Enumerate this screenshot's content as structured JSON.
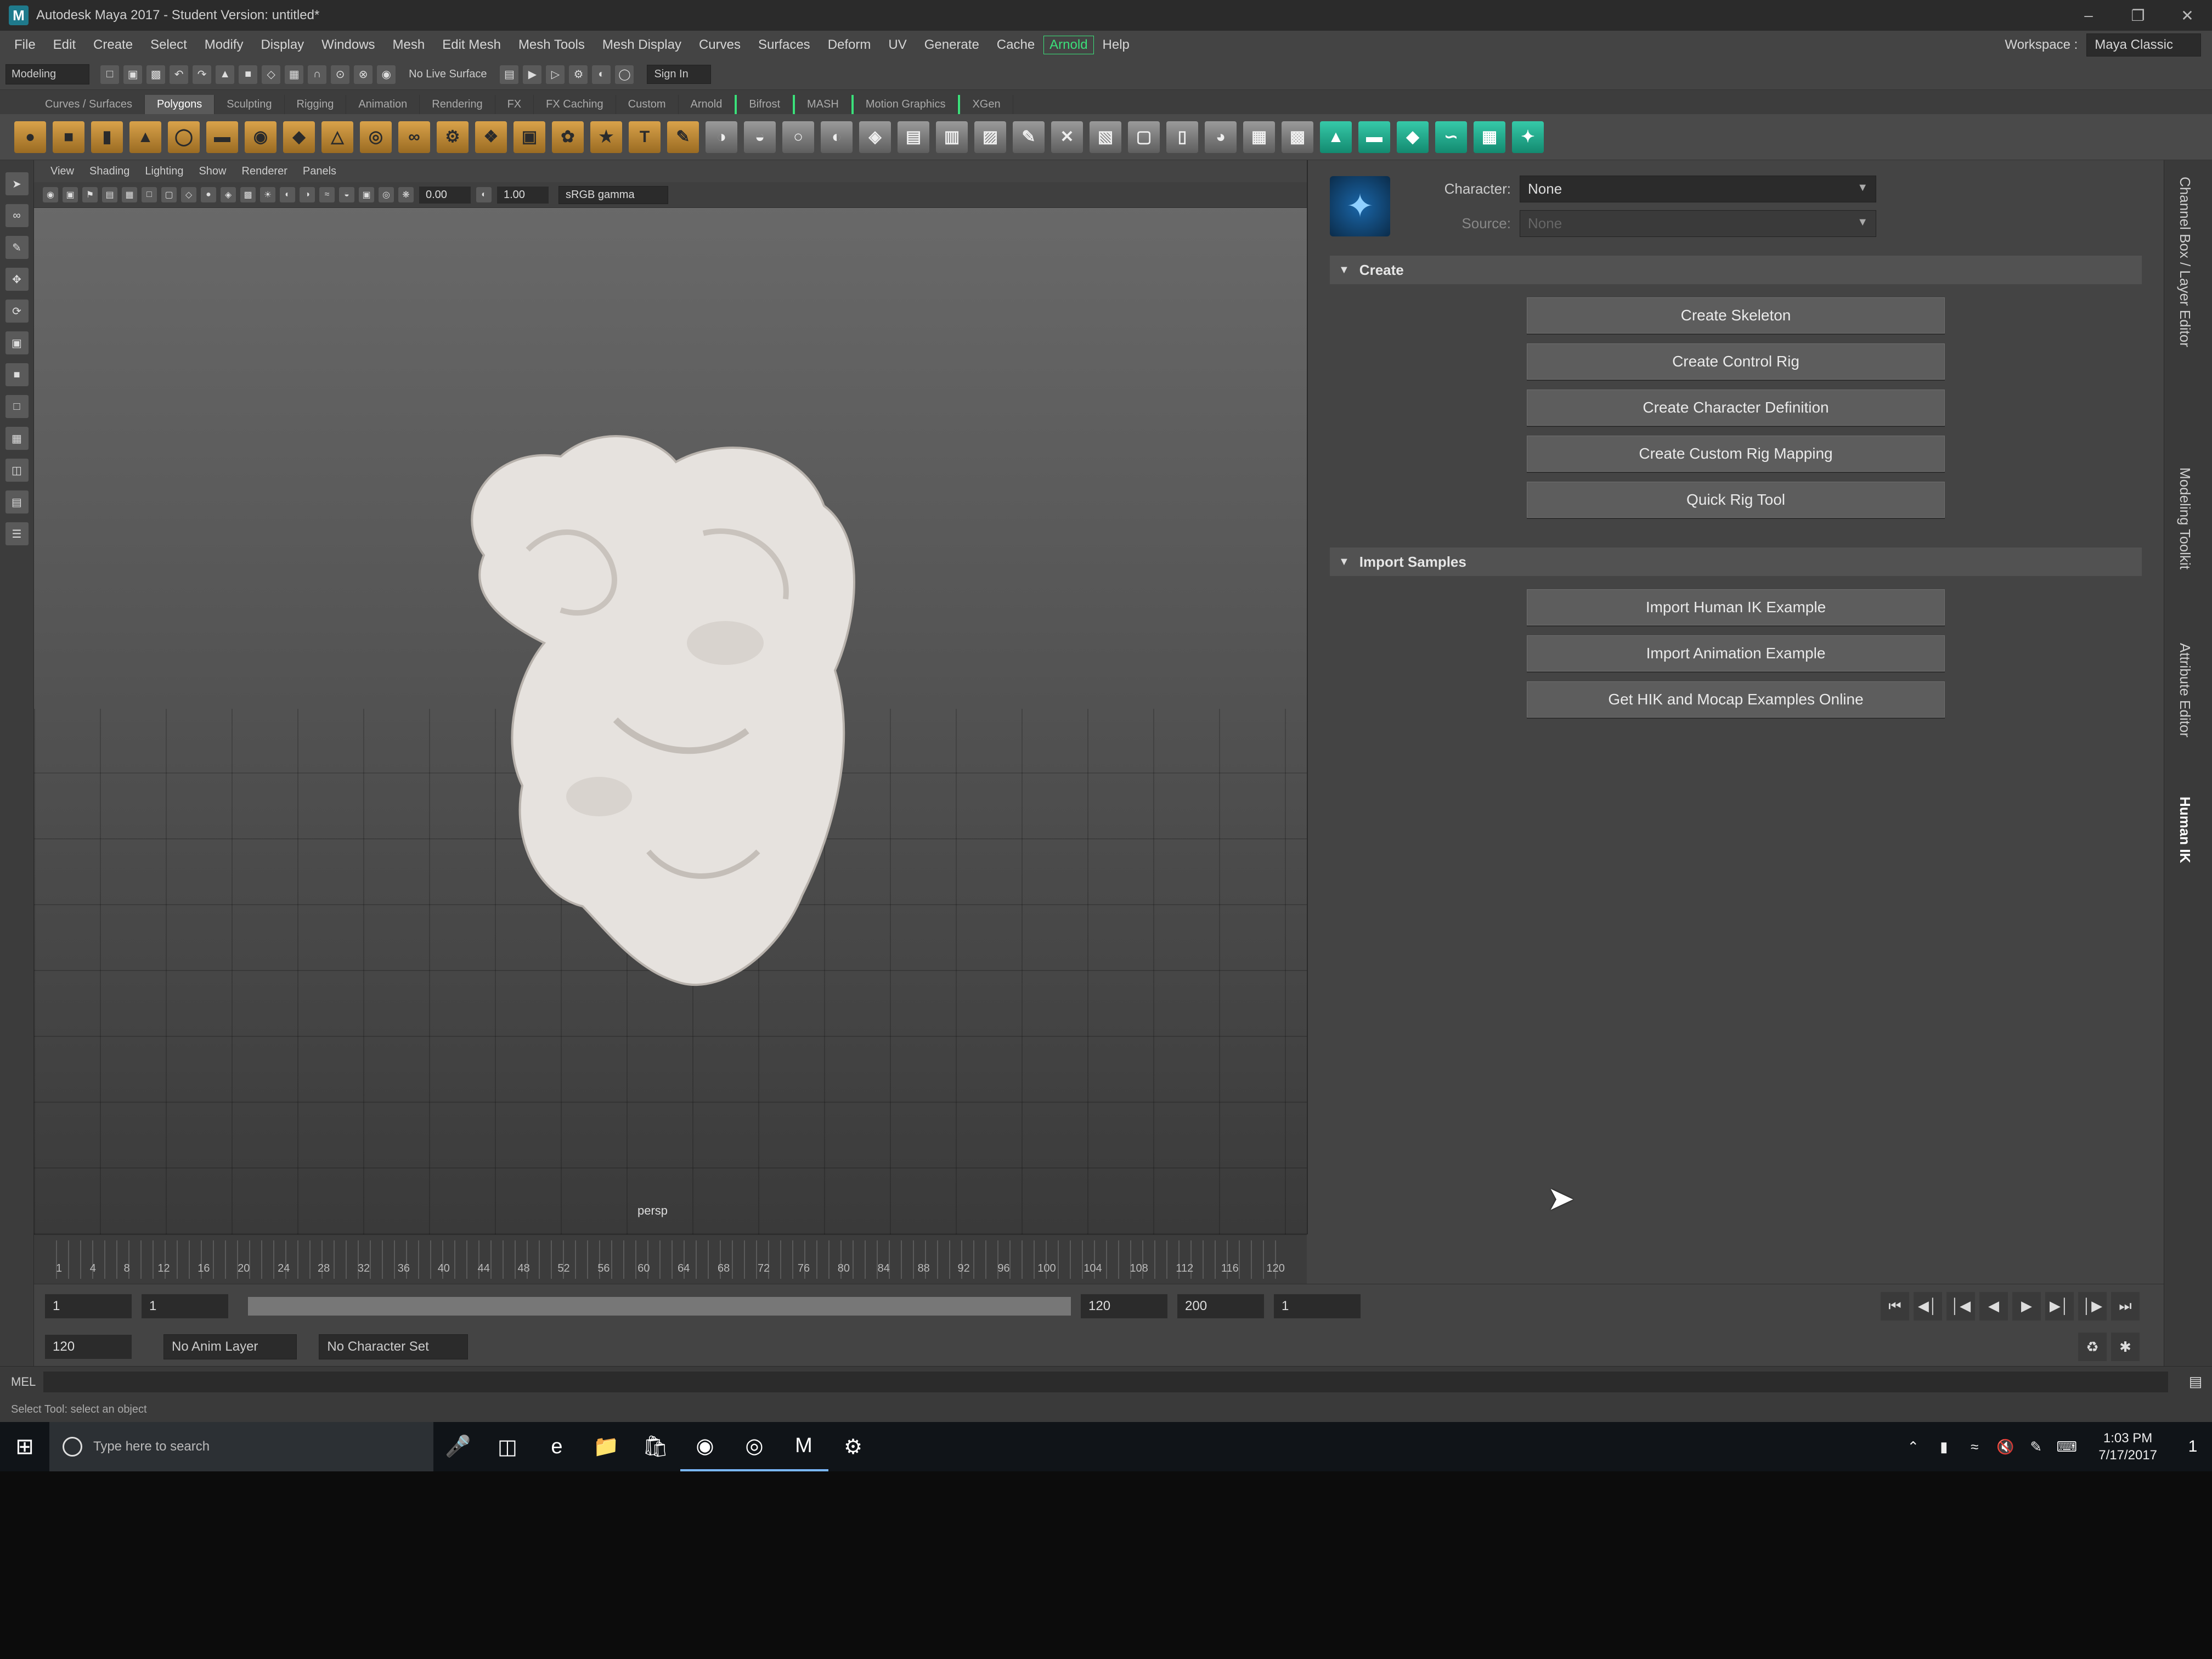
{
  "window": {
    "title": "Autodesk Maya 2017 - Student Version: untitled*",
    "app_icon": "M",
    "minimize": "–",
    "restore": "❐",
    "close": "✕"
  },
  "menus": [
    "File",
    "Edit",
    "Create",
    "Select",
    "Modify",
    "Display",
    "Windows",
    "Mesh",
    "Edit Mesh",
    "Mesh Tools",
    "Mesh Display",
    "Curves",
    "Surfaces",
    "Deform",
    "UV",
    "Generate",
    "Cache",
    "Arnold",
    "Help"
  ],
  "workspace": {
    "label": "Workspace :",
    "value": "Maya Classic"
  },
  "statusline": {
    "mode": "Modeling",
    "live_surface": "No Live Surface",
    "sign_in": "Sign In"
  },
  "shelf_tabs": [
    "Curves / Surfaces",
    "Polygons",
    "Sculpting",
    "Rigging",
    "Animation",
    "Rendering",
    "FX",
    "FX Caching",
    "Custom",
    "Arnold",
    "Bifrost",
    "MASH",
    "Motion Graphics",
    "XGen"
  ],
  "shelf_active": "Polygons",
  "viewport": {
    "menus": [
      "View",
      "Shading",
      "Lighting",
      "Show",
      "Renderer",
      "Panels"
    ],
    "field_a": "0.00",
    "field_b": "1.00",
    "color_space": "sRGB gamma",
    "camera": "persp"
  },
  "hik": {
    "character_label": "Character:",
    "character_value": "None",
    "source_label": "Source:",
    "source_value": "None",
    "create_section": "Create",
    "create_buttons": [
      "Create Skeleton",
      "Create Control Rig",
      "Create Character Definition",
      "Create Custom Rig Mapping",
      "Quick Rig Tool"
    ],
    "samples_section": "Import Samples",
    "sample_buttons": [
      "Import Human IK Example",
      "Import Animation Example",
      "Get HIK and Mocap Examples Online"
    ]
  },
  "side_tabs": [
    "Channel Box / Layer Editor",
    "Modeling Toolkit",
    "Attribute Editor",
    "Human IK"
  ],
  "side_tab_active": "Human IK",
  "timeline": {
    "ticks": [
      "1",
      "4",
      "8",
      "12",
      "16",
      "20",
      "24",
      "28",
      "32",
      "36",
      "40",
      "44",
      "48",
      "52",
      "56",
      "60",
      "64",
      "68",
      "72",
      "76",
      "80",
      "84",
      "88",
      "92",
      "96",
      "100",
      "104",
      "108",
      "112",
      "116",
      "120"
    ]
  },
  "range": {
    "start": "1",
    "start_inner": "1",
    "end_inner": "120",
    "end": "120",
    "max": "200",
    "current": "1",
    "anim_layer": "No Anim Layer",
    "char_set": "No Character Set"
  },
  "cmdline": {
    "lang": "MEL",
    "help": "Select Tool: select an object"
  },
  "taskbar": {
    "search_placeholder": "Type here to search",
    "time": "1:03 PM",
    "date": "7/17/2017",
    "notif_count": "1"
  },
  "colors": {
    "accent_green": "#3be07a",
    "maya_blue": "#3ab7e0",
    "panel_bg": "#444444"
  }
}
